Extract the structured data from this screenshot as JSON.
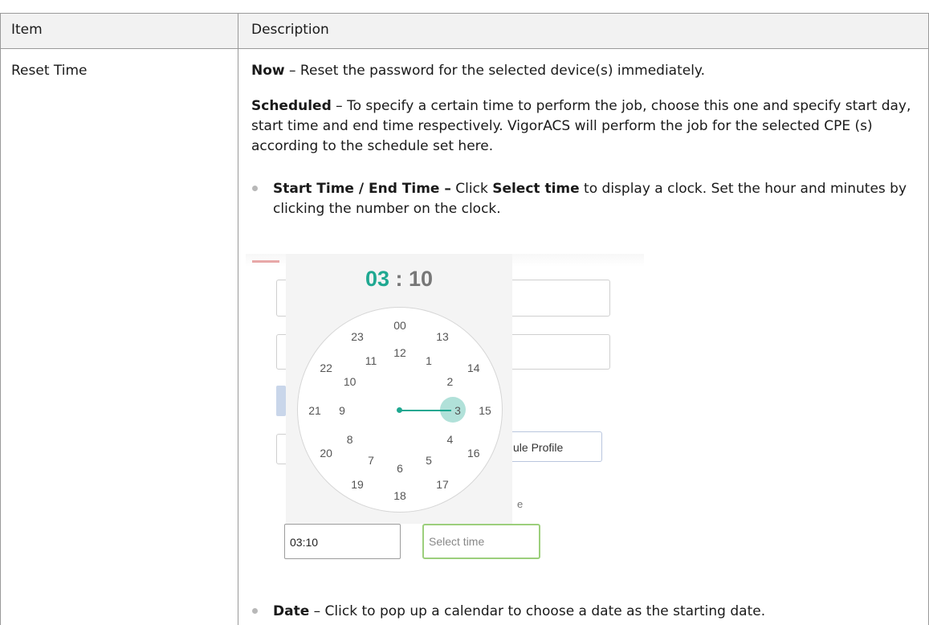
{
  "table": {
    "header": {
      "item": "Item",
      "description": "Description"
    },
    "row": {
      "item": "Reset Time",
      "now": {
        "term": "Now",
        "text": " – Reset the password for the selected device(s) immediately."
      },
      "scheduled": {
        "term": "Scheduled",
        "text": " – To specify a certain time to perform the job, choose this one and specify start day, start time and end time respectively. VigorACS will perform the job for the selected CPE (s) according to the schedule set here."
      },
      "bullet_start_end": {
        "term": "Start Time / End Time –",
        "text_a": " Click ",
        "link": "Select time",
        "text_b": " to display a clock. Set the hour and minutes by clicking the number on the clock."
      },
      "bullet_date": {
        "term": "Date",
        "text": " – Click to pop up a calendar to choose a date as the starting date."
      }
    }
  },
  "clock_picker": {
    "time_hour": "03",
    "time_sep": " : ",
    "time_minute": "10",
    "accent_color": "#1fa891",
    "outer_numbers": [
      "00",
      "13",
      "14",
      "15",
      "16",
      "17",
      "18",
      "19",
      "20",
      "21",
      "22",
      "23"
    ],
    "inner_numbers": [
      "12",
      "1",
      "2",
      "3",
      "4",
      "5",
      "6",
      "7",
      "8",
      "9",
      "10",
      "11"
    ],
    "selected_hour": "3",
    "profile_button_label": "ule Profile",
    "partial_label": "e",
    "time_input_value": "03:10",
    "select_time_placeholder": "Select time"
  }
}
